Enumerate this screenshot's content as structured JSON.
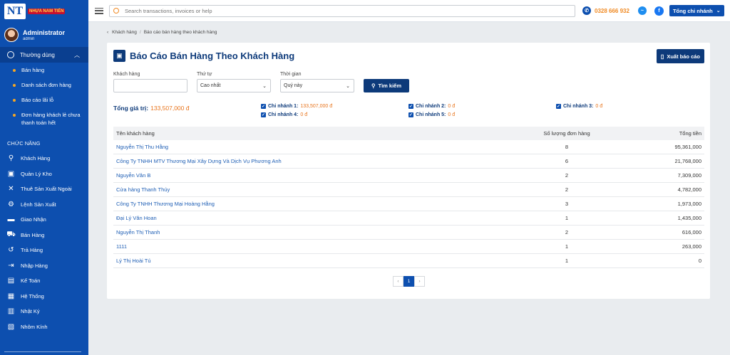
{
  "app": {
    "logo_mark": "NT",
    "logo_text": "NHỰA NAM TIẾN",
    "user_name": "Administrator",
    "user_role": "admin"
  },
  "sidebar": {
    "group_label": "Thường dùng",
    "sub_items": [
      {
        "label": "Bán hàng"
      },
      {
        "label": "Danh sách đơn hàng"
      },
      {
        "label": "Báo cáo lãi lỗ"
      },
      {
        "label": "Đơn hàng khách lẻ chưa thanh toán hết"
      }
    ],
    "section_title": "CHỨC NĂNG",
    "menu": [
      {
        "label": "Khách Hàng",
        "icon": "customer-icon"
      },
      {
        "label": "Quản Lý Kho",
        "icon": "warehouse-icon"
      },
      {
        "label": "Thuê Sản Xuất Ngoài",
        "icon": "tools-icon"
      },
      {
        "label": "Lệnh Sản Xuất",
        "icon": "production-icon"
      },
      {
        "label": "Giao Nhận",
        "icon": "truck-icon"
      },
      {
        "label": "Bán Hàng",
        "icon": "cart-icon"
      },
      {
        "label": "Trả Hàng",
        "icon": "return-icon"
      },
      {
        "label": "Nhập Hàng",
        "icon": "import-icon"
      },
      {
        "label": "Kế Toán",
        "icon": "accounting-icon"
      },
      {
        "label": "Hệ Thống",
        "icon": "system-icon"
      },
      {
        "label": "Nhật Ký",
        "icon": "log-icon"
      },
      {
        "label": "Nhôm Kính",
        "icon": "glass-icon"
      }
    ]
  },
  "topbar": {
    "search_placeholder": "Search transactions, invoices or help",
    "phone": "0328 666 932",
    "branch_select": "Tổng chi nhánh"
  },
  "breadcrumb": {
    "parent": "Khách hàng",
    "current": "Báo cáo bán hàng theo khách hàng"
  },
  "report": {
    "title": "Báo Cáo Bán Hàng Theo Khách Hàng",
    "export_label": "Xuất báo cáo",
    "filters": {
      "customer_label": "Khách hàng",
      "customer_value": "",
      "order_label": "Thứ tự",
      "order_value": "Cao nhất",
      "time_label": "Thời gian",
      "time_value": "Quý này",
      "search_label": "Tìm kiếm"
    },
    "total_label": "Tổng giá trị:",
    "total_value": "133,507,000 đ",
    "branches": [
      {
        "label": "Chi nhánh 1:",
        "value": "133,507,000 đ"
      },
      {
        "label": "Chi nhánh 2:",
        "value": "0 đ"
      },
      {
        "label": "Chi nhánh 3:",
        "value": "0 đ"
      },
      {
        "label": "Chi nhánh 4:",
        "value": "0 đ"
      },
      {
        "label": "Chi nhánh 5:",
        "value": "0 đ"
      }
    ],
    "table": {
      "headers": [
        "Tên khách hàng",
        "Số lượng đơn hàng",
        "Tổng tiền"
      ],
      "rows": [
        [
          "Nguyễn Thị Thu Hằng",
          "8",
          "95,361,000"
        ],
        [
          "Công Ty TNHH MTV Thương Mại Xây Dựng Và Dịch Vụ Phương Anh",
          "6",
          "21,768,000"
        ],
        [
          "Nguyễn Văn B",
          "2",
          "7,309,000"
        ],
        [
          "Cửa hàng Thanh Thúy",
          "2",
          "4,782,000"
        ],
        [
          "Công Ty TNHH Thương Mại Hoàng Hằng",
          "3",
          "1,973,000"
        ],
        [
          "Đại Lý Văn Hoan",
          "1",
          "1,435,000"
        ],
        [
          "Nguyễn Thị Thanh",
          "2",
          "616,000"
        ],
        [
          "1111",
          "1",
          "263,000"
        ],
        [
          "Lý Thị Hoài Tú",
          "1",
          "0"
        ]
      ]
    },
    "pager": {
      "prev": "‹",
      "current": "1",
      "next": "›"
    }
  }
}
